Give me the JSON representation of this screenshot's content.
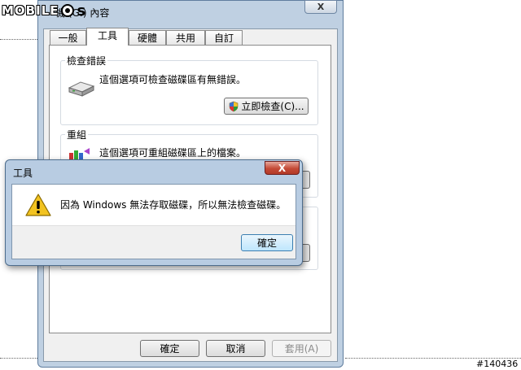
{
  "watermark": {
    "text": "MOBILE",
    "suffix": "s"
  },
  "window": {
    "title": "機 (G:) 內容",
    "close_glyph": "X"
  },
  "tabs": [
    {
      "label": "一般"
    },
    {
      "label": "工具"
    },
    {
      "label": "硬體"
    },
    {
      "label": "共用"
    },
    {
      "label": "自訂"
    }
  ],
  "check_group": {
    "label": "檢查錯誤",
    "description": "這個選項可檢查磁碟區有無錯誤。",
    "button": "立即檢查(C)..."
  },
  "defrag_group": {
    "label": "重組",
    "description": "這個選項可重組磁碟區上的檔案。"
  },
  "footer_buttons": {
    "ok": "確定",
    "cancel": "取消",
    "apply": "套用(A)"
  },
  "dialog": {
    "title": "工具",
    "close_glyph": "X",
    "message": "因為 Windows 無法存取磁碟，所以無法檢查磁碟。",
    "ok": "確定"
  },
  "image_id": "#140436"
}
